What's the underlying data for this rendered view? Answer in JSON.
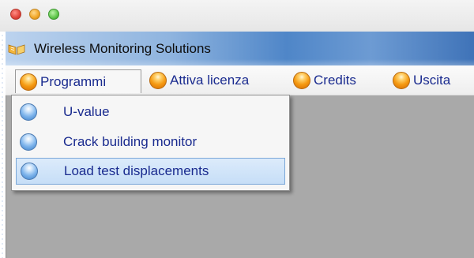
{
  "window": {
    "title": "Wireless Monitoring Solutions"
  },
  "menubar": {
    "items": [
      {
        "label": "Programmi",
        "icon": "orange-orb-icon",
        "open": true
      },
      {
        "label": "Attiva licenza",
        "icon": "orange-orb-icon"
      },
      {
        "label": "Credits",
        "icon": "orange-orb-icon"
      },
      {
        "label": "Uscita",
        "icon": "orange-orb-icon"
      }
    ]
  },
  "dropdown": {
    "items": [
      {
        "label": "U-value",
        "icon": "blue-orb-icon",
        "selected": false
      },
      {
        "label": "Crack building monitor",
        "icon": "blue-orb-icon",
        "selected": false
      },
      {
        "label": "Load test displacements",
        "icon": "blue-orb-icon",
        "selected": true
      }
    ]
  },
  "colors": {
    "menu_text": "#1a2b8f",
    "title_bar_accent": "#4f86c8",
    "workspace": "#a9a9a9",
    "selection_bg": "#c6def7"
  }
}
